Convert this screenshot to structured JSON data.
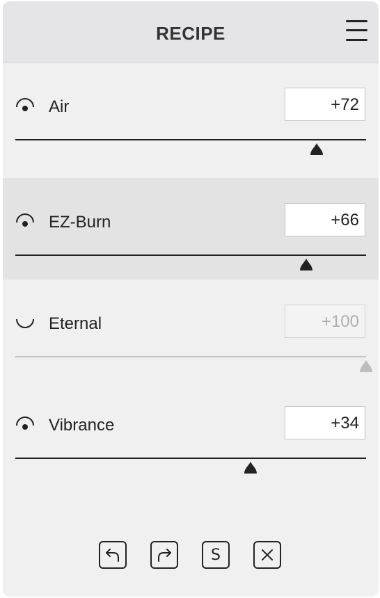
{
  "header": {
    "title": "RECIPE",
    "menu_icon": "hamburger-menu-icon"
  },
  "sliders": [
    {
      "name": "air",
      "label": "Air",
      "value": "+72",
      "numeric": 72,
      "enabled": true,
      "active": false
    },
    {
      "name": "ez-burn",
      "label": "EZ-Burn",
      "value": "+66",
      "numeric": 66,
      "enabled": true,
      "active": true
    },
    {
      "name": "eternal",
      "label": "Eternal",
      "value": "+100",
      "numeric": 100,
      "enabled": false,
      "active": false
    },
    {
      "name": "vibrance",
      "label": "Vibrance",
      "value": "+34",
      "numeric": 34,
      "enabled": true,
      "active": false
    }
  ],
  "slider_range": [
    -100,
    100
  ],
  "toolbar": {
    "buttons": [
      {
        "name": "undo",
        "icon": "undo-arrow-icon"
      },
      {
        "name": "redo",
        "icon": "redo-arrow-icon"
      },
      {
        "name": "save",
        "icon": "s-icon",
        "glyph": "S"
      },
      {
        "name": "close",
        "icon": "close-x-icon"
      }
    ]
  },
  "colors": {
    "panel_bg": "#f0f0f0",
    "header_bg": "#e5e4e6",
    "active_row_bg": "#e3e3e3",
    "ink": "#222222",
    "disabled": "#c4c4c4"
  }
}
